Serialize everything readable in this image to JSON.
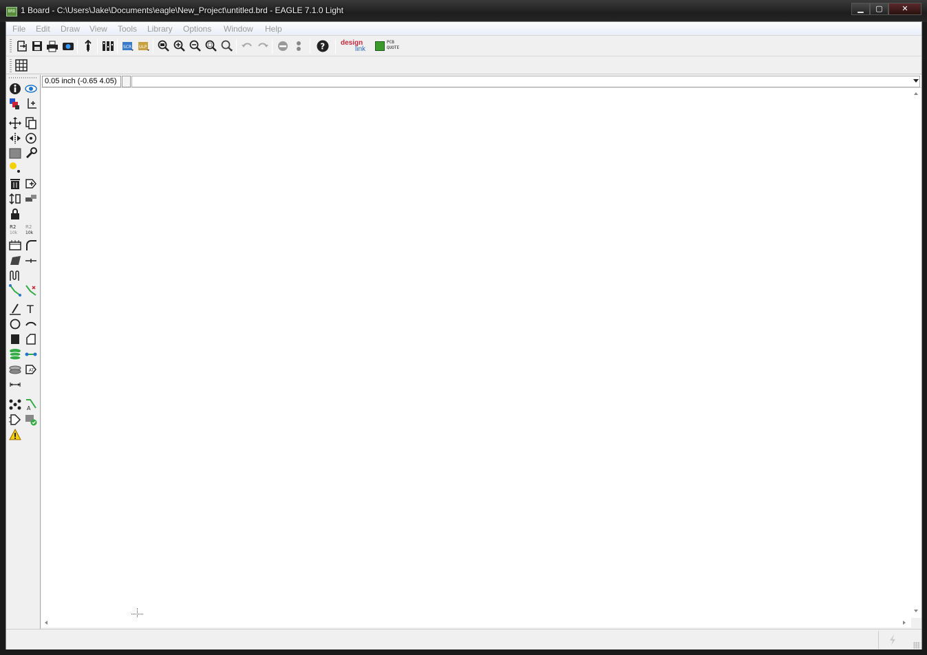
{
  "window": {
    "title": "1 Board - C:\\Users\\Jake\\Documents\\eagle\\New_Project\\untitled.brd - EAGLE 7.1.0 Light",
    "app_icon_label": "BRD",
    "minimize_label": "▁",
    "maximize_label": "▢",
    "close_label": "✕"
  },
  "menu": {
    "items": [
      "File",
      "Edit",
      "Draw",
      "View",
      "Tools",
      "Library",
      "Options",
      "Window",
      "Help"
    ]
  },
  "toolbar": {
    "buttons": [
      {
        "name": "open-icon"
      },
      {
        "name": "save-icon"
      },
      {
        "name": "print-icon"
      },
      {
        "name": "cam-processor-icon"
      },
      {
        "name": "switch-schematic-icon"
      },
      {
        "name": "layer-settings-icon"
      },
      {
        "name": "script-icon",
        "label": "SCR"
      },
      {
        "name": "ulp-icon",
        "label": "ULP"
      },
      {
        "name": "zoom-fit-icon"
      },
      {
        "name": "zoom-in-icon"
      },
      {
        "name": "zoom-out-icon"
      },
      {
        "name": "zoom-select-icon"
      },
      {
        "name": "zoom-redraw-icon"
      },
      {
        "name": "undo-icon"
      },
      {
        "name": "redo-icon"
      },
      {
        "name": "stop-command-icon"
      },
      {
        "name": "go-icon"
      },
      {
        "name": "help-icon"
      }
    ],
    "designlink": {
      "line1": "design",
      "line2": "link"
    },
    "pcbquote": {
      "line1": "PCB",
      "line2": "QUOTE"
    }
  },
  "toolbar2": {
    "grid_button": "grid-icon"
  },
  "cmdbar": {
    "coordinate": "0.05 inch (-0.65 4.05)",
    "command_value": "",
    "command_placeholder": ""
  },
  "status": {
    "text": ""
  },
  "left_tools": [
    [
      "info-icon",
      "show-icon"
    ],
    [
      "display-layers-icon",
      "mark-icon"
    ],
    [
      "move-icon",
      "copy-icon"
    ],
    [
      "mirror-icon",
      "rotate-icon"
    ],
    [
      "group-icon",
      "change-icon"
    ],
    [
      "paste-icon",
      ""
    ],
    [
      "delete-icon",
      "add-icon"
    ],
    [
      "replace-icon",
      "lock-alt-icon"
    ],
    [
      "lock-icon",
      ""
    ],
    [
      "name-icon",
      "value-icon"
    ],
    [
      "smash-icon",
      "miter-icon"
    ],
    [
      "split-icon",
      "optimize-icon"
    ],
    [
      "meander-icon",
      ""
    ],
    [
      "route-icon",
      "ripup-icon"
    ],
    [
      "wire-icon",
      "text-icon"
    ],
    [
      "circle-icon",
      "arc-icon"
    ],
    [
      "rect-icon",
      "polygon-icon"
    ],
    [
      "via-icon",
      "signal-icon"
    ],
    [
      "hole-icon",
      "attribute-icon"
    ],
    [
      "dimension-icon",
      ""
    ],
    [
      "ratsnest-icon",
      "autorouter-icon"
    ],
    [
      "erc-icon",
      "drc-icon"
    ],
    [
      "errors-icon",
      ""
    ]
  ],
  "colors": {
    "accent_red": "#cc2233",
    "accent_blue": "#2277cc",
    "accent_green": "#33aa44",
    "yellow": "#f4d000"
  }
}
